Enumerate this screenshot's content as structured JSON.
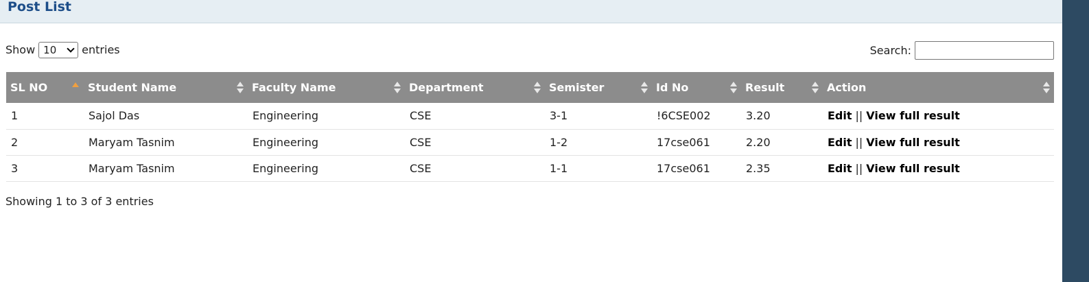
{
  "header": {
    "title": "Post List"
  },
  "controls": {
    "show_label": "Show",
    "page_length": "10",
    "entries_label": "entries",
    "search_label": "Search:",
    "search_value": ""
  },
  "table": {
    "columns": [
      "SL NO",
      "Student Name",
      "Faculty Name",
      "Department",
      "Semister",
      "Id No",
      "Result",
      "Action"
    ],
    "rows": [
      {
        "sl": "1",
        "student": "Sajol Das",
        "faculty": "Engineering",
        "department": "CSE",
        "semister": "3-1",
        "id_no": "!6CSE002",
        "result": "3.20"
      },
      {
        "sl": "2",
        "student": "Maryam Tasnim",
        "faculty": "Engineering",
        "department": "CSE",
        "semister": "1-2",
        "id_no": "17cse061",
        "result": "2.20"
      },
      {
        "sl": "3",
        "student": "Maryam Tasnim",
        "faculty": "Engineering",
        "department": "CSE",
        "semister": "1-1",
        "id_no": "17cse061",
        "result": "2.35"
      }
    ],
    "action": {
      "edit_label": "Edit",
      "separator": "||",
      "view_label": "View full result"
    }
  },
  "footer": {
    "info": "Showing 1 to 3 of 3 entries"
  },
  "colors": {
    "header_bg": "#e6eef3",
    "title_color": "#1d4e89",
    "table_head_bg": "#8c8c8c",
    "sort_active": "#f0a040",
    "side_bar": "#2d4a62"
  }
}
